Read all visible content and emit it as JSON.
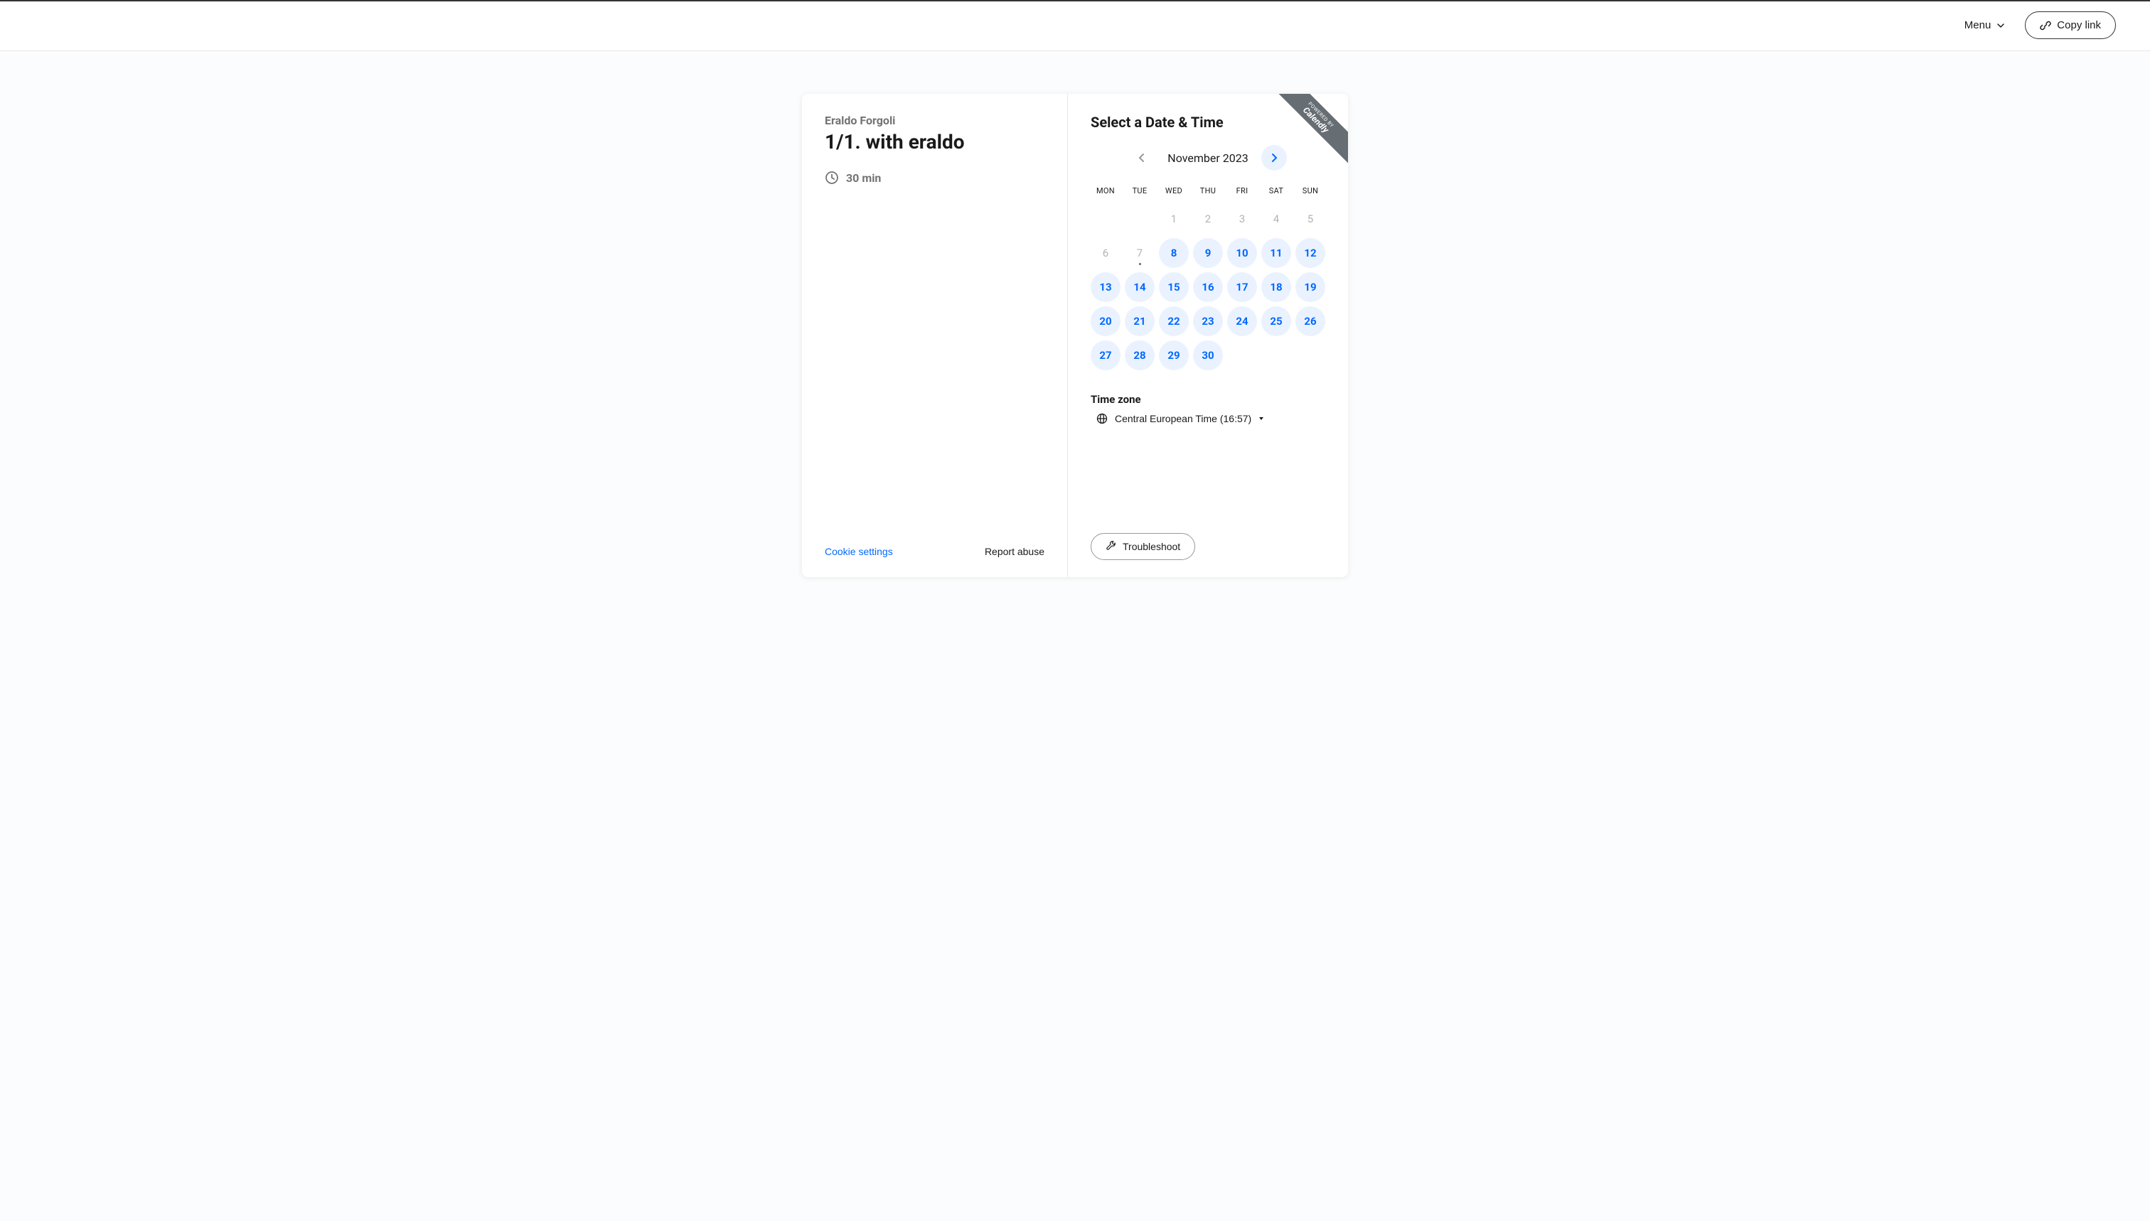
{
  "topbar": {
    "menu_label": "Menu",
    "copy_link_label": "Copy link"
  },
  "event": {
    "host_name": "Eraldo Forgoli",
    "title": "1/1. with eraldo",
    "duration": "30 min"
  },
  "date_picker": {
    "title": "Select a Date & Time",
    "month_label": "November 2023",
    "day_headers": [
      "MON",
      "TUE",
      "WED",
      "THU",
      "FRI",
      "SAT",
      "SUN"
    ],
    "days": [
      {
        "n": "",
        "state": "empty"
      },
      {
        "n": "",
        "state": "empty"
      },
      {
        "n": "1",
        "state": "unavailable"
      },
      {
        "n": "2",
        "state": "unavailable"
      },
      {
        "n": "3",
        "state": "unavailable"
      },
      {
        "n": "4",
        "state": "unavailable"
      },
      {
        "n": "5",
        "state": "unavailable"
      },
      {
        "n": "6",
        "state": "unavailable"
      },
      {
        "n": "7",
        "state": "unavailable",
        "today": true
      },
      {
        "n": "8",
        "state": "available"
      },
      {
        "n": "9",
        "state": "available"
      },
      {
        "n": "10",
        "state": "available"
      },
      {
        "n": "11",
        "state": "available"
      },
      {
        "n": "12",
        "state": "available"
      },
      {
        "n": "13",
        "state": "available"
      },
      {
        "n": "14",
        "state": "available"
      },
      {
        "n": "15",
        "state": "available"
      },
      {
        "n": "16",
        "state": "available"
      },
      {
        "n": "17",
        "state": "available"
      },
      {
        "n": "18",
        "state": "available"
      },
      {
        "n": "19",
        "state": "available"
      },
      {
        "n": "20",
        "state": "available"
      },
      {
        "n": "21",
        "state": "available"
      },
      {
        "n": "22",
        "state": "available"
      },
      {
        "n": "23",
        "state": "available"
      },
      {
        "n": "24",
        "state": "available"
      },
      {
        "n": "25",
        "state": "available"
      },
      {
        "n": "26",
        "state": "available"
      },
      {
        "n": "27",
        "state": "available"
      },
      {
        "n": "28",
        "state": "available"
      },
      {
        "n": "29",
        "state": "available"
      },
      {
        "n": "30",
        "state": "available"
      }
    ]
  },
  "timezone": {
    "label": "Time zone",
    "value": "Central European Time (16:57)"
  },
  "footer": {
    "cookie_settings": "Cookie settings",
    "report_abuse": "Report abuse",
    "troubleshoot": "Troubleshoot"
  },
  "ribbon": {
    "powered_by": "POWERED BY",
    "brand": "Calendly"
  }
}
